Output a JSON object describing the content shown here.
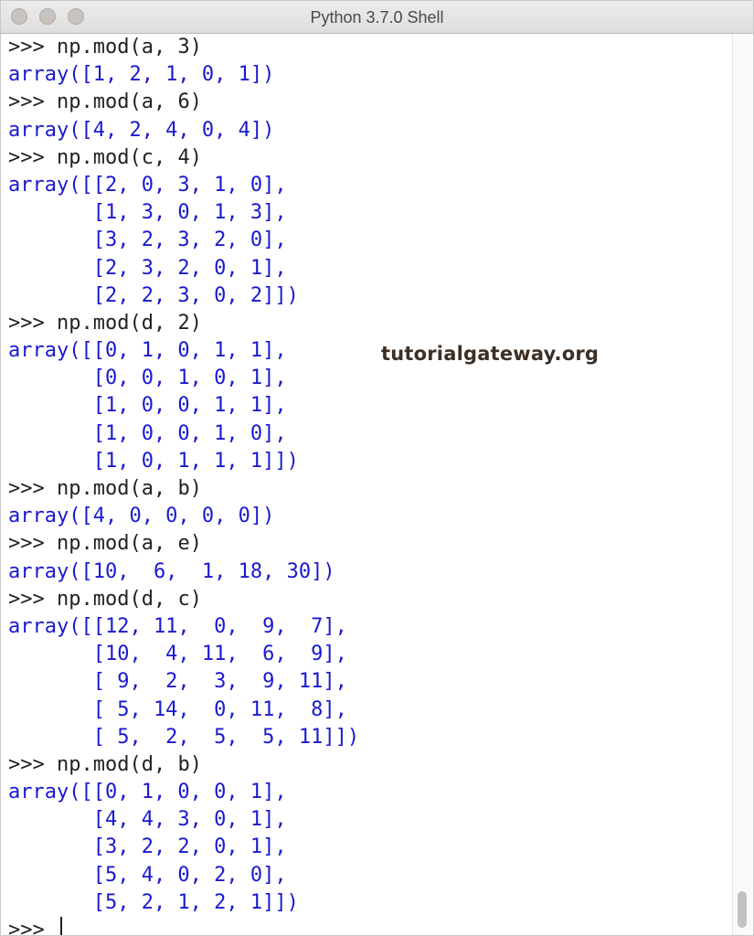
{
  "window": {
    "title": "Python 3.7.0 Shell"
  },
  "watermark": "tutorialgateway.org",
  "shell": {
    "prompt": ">>>",
    "lines": [
      {
        "kind": "input",
        "text": "np.mod(a, 3)"
      },
      {
        "kind": "output",
        "text": "array([1, 2, 1, 0, 1])"
      },
      {
        "kind": "input",
        "text": "np.mod(a, 6)"
      },
      {
        "kind": "output",
        "text": "array([4, 2, 4, 0, 4])"
      },
      {
        "kind": "input",
        "text": "np.mod(c, 4)"
      },
      {
        "kind": "output",
        "text": "array([[2, 0, 3, 1, 0],"
      },
      {
        "kind": "output",
        "text": "       [1, 3, 0, 1, 3],"
      },
      {
        "kind": "output",
        "text": "       [3, 2, 3, 2, 0],"
      },
      {
        "kind": "output",
        "text": "       [2, 3, 2, 0, 1],"
      },
      {
        "kind": "output",
        "text": "       [2, 2, 3, 0, 2]])"
      },
      {
        "kind": "input",
        "text": "np.mod(d, 2)"
      },
      {
        "kind": "output",
        "text": "array([[0, 1, 0, 1, 1],"
      },
      {
        "kind": "output",
        "text": "       [0, 0, 1, 0, 1],"
      },
      {
        "kind": "output",
        "text": "       [1, 0, 0, 1, 1],"
      },
      {
        "kind": "output",
        "text": "       [1, 0, 0, 1, 0],"
      },
      {
        "kind": "output",
        "text": "       [1, 0, 1, 1, 1]])"
      },
      {
        "kind": "input",
        "text": "np.mod(a, b)"
      },
      {
        "kind": "output",
        "text": "array([4, 0, 0, 0, 0])"
      },
      {
        "kind": "input",
        "text": "np.mod(a, e)"
      },
      {
        "kind": "output",
        "text": "array([10,  6,  1, 18, 30])"
      },
      {
        "kind": "input",
        "text": "np.mod(d, c)"
      },
      {
        "kind": "output",
        "text": "array([[12, 11,  0,  9,  7],"
      },
      {
        "kind": "output",
        "text": "       [10,  4, 11,  6,  9],"
      },
      {
        "kind": "output",
        "text": "       [ 9,  2,  3,  9, 11],"
      },
      {
        "kind": "output",
        "text": "       [ 5, 14,  0, 11,  8],"
      },
      {
        "kind": "output",
        "text": "       [ 5,  2,  5,  5, 11]])"
      },
      {
        "kind": "input",
        "text": "np.mod(d, b)"
      },
      {
        "kind": "output",
        "text": "array([[0, 1, 0, 0, 1],"
      },
      {
        "kind": "output",
        "text": "       [4, 4, 3, 0, 1],"
      },
      {
        "kind": "output",
        "text": "       [3, 2, 2, 0, 1],"
      },
      {
        "kind": "output",
        "text": "       [5, 4, 0, 2, 0],"
      },
      {
        "kind": "output",
        "text": "       [5, 2, 1, 2, 1]])"
      },
      {
        "kind": "input",
        "text": ""
      }
    ]
  }
}
